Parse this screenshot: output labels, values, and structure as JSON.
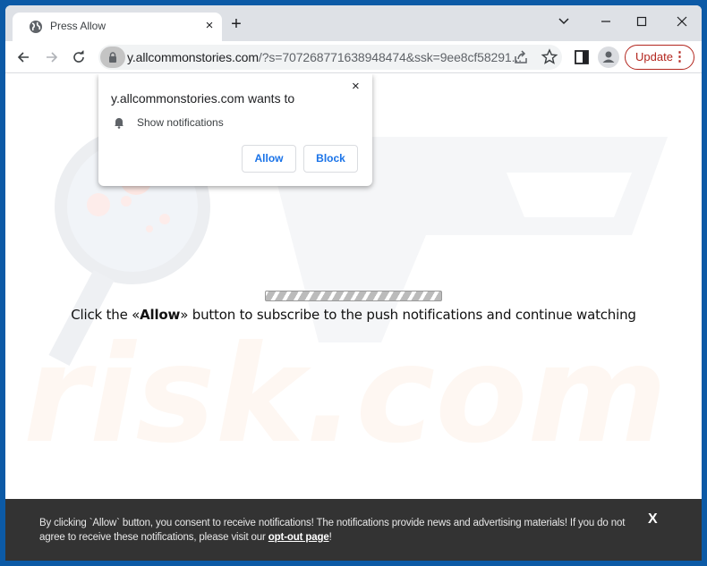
{
  "browser": {
    "tab": {
      "title": "Press Allow",
      "favicon": "globe-icon",
      "close": "×"
    },
    "new_tab": "+",
    "window_controls": {
      "tab_search": "⌄",
      "minimize": "—",
      "maximize": "☐",
      "close": "✕"
    },
    "nav": {
      "back": "←",
      "forward": "→",
      "reload": "↻"
    },
    "address": {
      "host": "y.allcommonstories.com",
      "path": "/?s=707268771638948474&ssk=9ee8cf58291..."
    },
    "update_button": {
      "label": "Update",
      "menu": "⋮"
    },
    "colors": {
      "frame": "#0c5aa6",
      "tabstrip": "#dee1e6",
      "update": "#b3261e",
      "link_blue": "#1a73e8"
    }
  },
  "permission_popup": {
    "title": "y.allcommonstories.com wants to",
    "permission": "Show notifications",
    "close": "×",
    "allow_label": "Allow",
    "block_label": "Block"
  },
  "page": {
    "message_pre": "Click the «",
    "message_bold": "Allow",
    "message_post": "» button to subscribe to the push notifications and continue watching",
    "progress_state": "indeterminate"
  },
  "consent_bar": {
    "text": "By clicking `Allow` button, you consent to receive notifications! The notifications provide news and advertising materials! If you do not agree to receive these notifications, please visit our ",
    "link": "opt-out page",
    "suffix": "!",
    "close": "X"
  },
  "watermark": {
    "text": "PC risk.com"
  }
}
